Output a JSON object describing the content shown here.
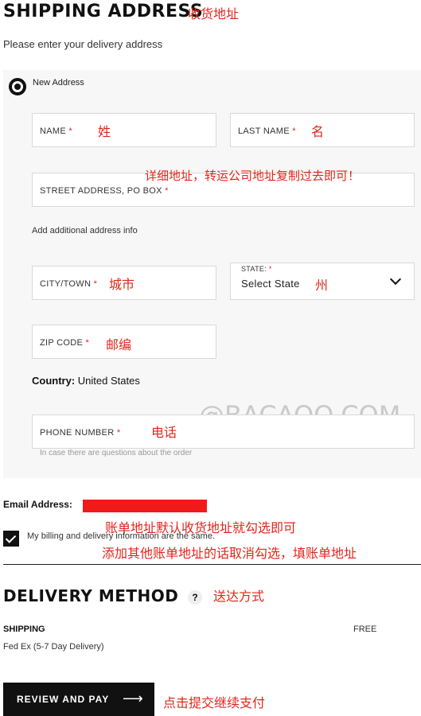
{
  "header": {
    "title": "SHIPPING ADDRESS",
    "title_note": "收货地址",
    "subtitle": "Please enter your delivery address"
  },
  "address_option": {
    "label": "New Address",
    "selected": true
  },
  "form": {
    "name": {
      "label": "NAME",
      "required": "*",
      "note": "姓"
    },
    "last_name": {
      "label": "LAST NAME",
      "required": "*",
      "note": "名"
    },
    "street": {
      "label": "STREET ADDRESS, PO BOX",
      "required": "*",
      "note": "详细地址，转运公司地址复制过去即可！"
    },
    "additional_link": "Add additional address info",
    "city": {
      "label": "CITY/TOWN",
      "required": "*",
      "note": "城市"
    },
    "state": {
      "label": "STATE:",
      "required": "*",
      "value": "Select State",
      "note": "州"
    },
    "zip": {
      "label": "ZIP CODE",
      "required": "*",
      "note": "邮编"
    },
    "country": {
      "label": "Country:",
      "value": "United States"
    },
    "phone": {
      "label": "PHONE NUMBER",
      "required": "*",
      "note": "电话",
      "hint": "In case there are questions about the order"
    }
  },
  "watermark": "@BACAOO.COM",
  "email": {
    "label": "Email Address:"
  },
  "billing": {
    "checked": true,
    "label": "My billing and delivery information are the same.",
    "note_line1": "账单地址默认收货地址就勾选即可",
    "note_line2": "添加其他账单地址的话取消勾选，填账单地址"
  },
  "delivery": {
    "title": "DELIVERY METHOD",
    "help_icon": "?",
    "note": "送达方式",
    "shipping_label": "SHIPPING",
    "shipping_price": "FREE",
    "shipping_method": "Fed Ex (5-7 Day Delivery)"
  },
  "review_button": {
    "label": "REVIEW AND PAY",
    "arrow": "⟶",
    "note": "点击提交继续支付"
  },
  "colors": {
    "annotation": "#e0261b",
    "panel_bg": "#f7f7f7",
    "button_bg": "#111111"
  }
}
